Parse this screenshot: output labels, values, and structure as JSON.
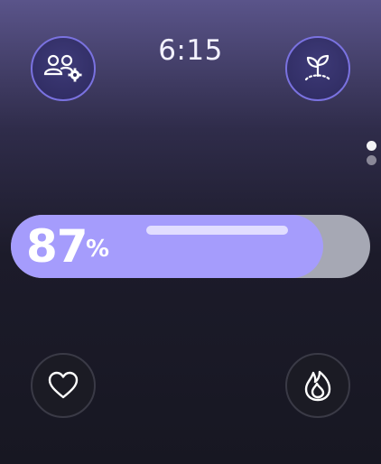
{
  "status": {
    "time": "6:15"
  },
  "top_left_button": {
    "icon": "user-group-settings-icon",
    "accent": "#7a72e0"
  },
  "top_right_button": {
    "icon": "sprout-icon",
    "accent": "#7a72e0"
  },
  "pager": {
    "pages": 2,
    "active_index": 0
  },
  "level": {
    "value": "87",
    "unit": "%",
    "fraction": 0.87,
    "fill_color": "#a59cfc",
    "track_color": "#a6a8b4"
  },
  "bottom_left_button": {
    "icon": "heart-icon"
  },
  "bottom_right_button": {
    "icon": "flame-icon"
  }
}
